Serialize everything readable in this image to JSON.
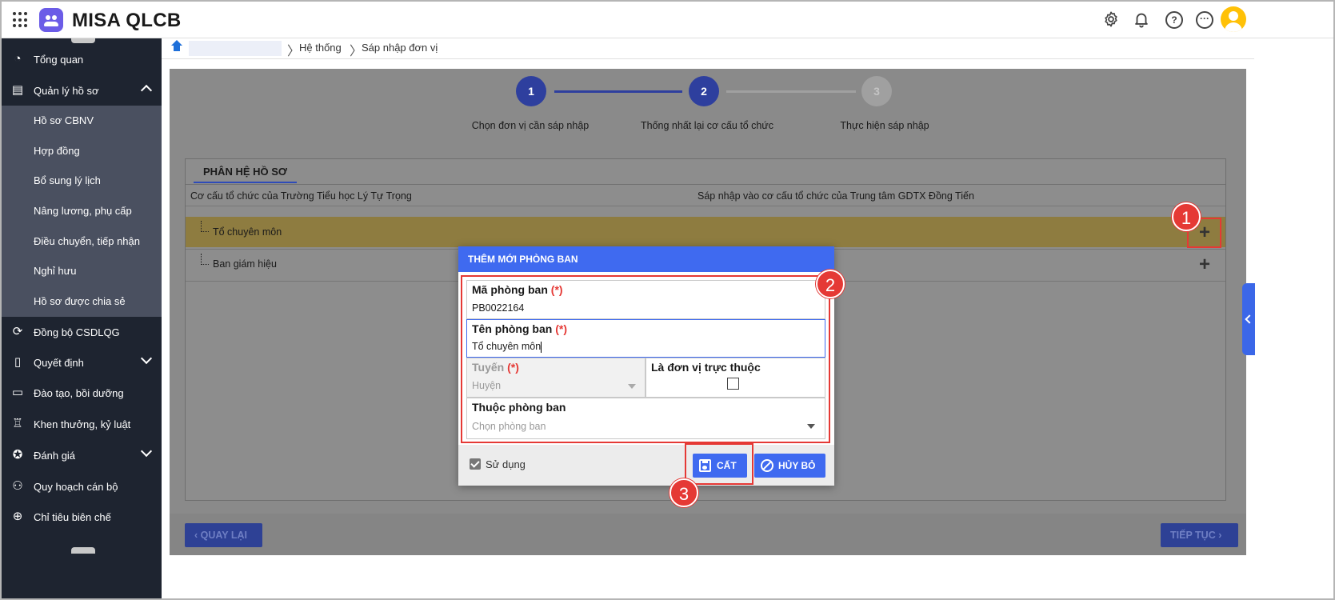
{
  "app": {
    "brand": "MISA QLCB"
  },
  "header_icons": [
    "gear-icon",
    "bell-icon",
    "help-icon",
    "more-icon"
  ],
  "sidebar": {
    "items": [
      {
        "label": "Tổng quan",
        "icon": "pie-chart-icon"
      },
      {
        "label": "Quản lý hồ sơ",
        "icon": "id-card-icon",
        "expanded": true
      },
      {
        "label": "Đồng bộ CSDLQG",
        "icon": "sync-icon"
      },
      {
        "label": "Quyết định",
        "icon": "document-icon"
      },
      {
        "label": "Đào tạo, bồi dưỡng",
        "icon": "presentation-icon"
      },
      {
        "label": "Khen thưởng, kỷ luật",
        "icon": "trophy-icon"
      },
      {
        "label": "Đánh giá",
        "icon": "award-icon"
      },
      {
        "label": "Quy hoạch cán bộ",
        "icon": "users-icon"
      },
      {
        "label": "Chỉ tiêu biên chế",
        "icon": "target-icon"
      }
    ],
    "subitems": [
      "Hồ sơ CBNV",
      "Hợp đồng",
      "Bổ sung lý lịch",
      "Nâng lương, phụ cấp",
      "Điều chuyển, tiếp nhận",
      "Nghỉ hưu",
      "Hồ sơ được chia sẻ"
    ]
  },
  "breadcrumb": {
    "items": [
      "Hệ thống",
      "Sáp nhập đơn vị"
    ]
  },
  "stepper": {
    "steps": [
      {
        "num": "1",
        "label": "Chọn đơn vị cần sáp nhập"
      },
      {
        "num": "2",
        "label": "Thống nhất lại cơ cấu tổ chức"
      },
      {
        "num": "3",
        "label": "Thực hiện sáp nhập"
      }
    ],
    "active_color": "#2e3f9e",
    "inactive_color": "#a0a0a0"
  },
  "panel": {
    "tab": "PHÂN HỆ HỒ SƠ",
    "col_left": "Cơ cấu tổ chức của Trường Tiểu học Lý Tự Trọng",
    "col_right": "Sáp nhập vào cơ cấu tổ chức của Trung tâm GDTX Đồng Tiến",
    "rows": [
      "Tổ chuyên môn",
      "Ban giám hiệu"
    ]
  },
  "footer": {
    "back": "QUAY LẠI",
    "next": "TIẾP TỤC"
  },
  "modal": {
    "title": "THÊM MỚI PHÒNG BAN",
    "code_label": "Mã phòng ban",
    "code_value": "PB0022164",
    "name_label": "Tên phòng ban",
    "name_value": "Tổ chuyên môn",
    "level_label": "Tuyến",
    "level_value": "Huyện",
    "affiliated_label": "Là đơn vị trực thuộc",
    "parent_label": "Thuộc phòng ban",
    "parent_placeholder": "Chọn phòng ban",
    "required_mark": "(*)",
    "use_label": "Sử dụng",
    "save_label": "CẤT",
    "cancel_label": "HỦY BỎ"
  },
  "annotations": [
    "1",
    "2",
    "3"
  ],
  "colors": {
    "accent": "#3f6af0",
    "sidebar_bg": "#1e2430",
    "annotation": "#e53935"
  }
}
